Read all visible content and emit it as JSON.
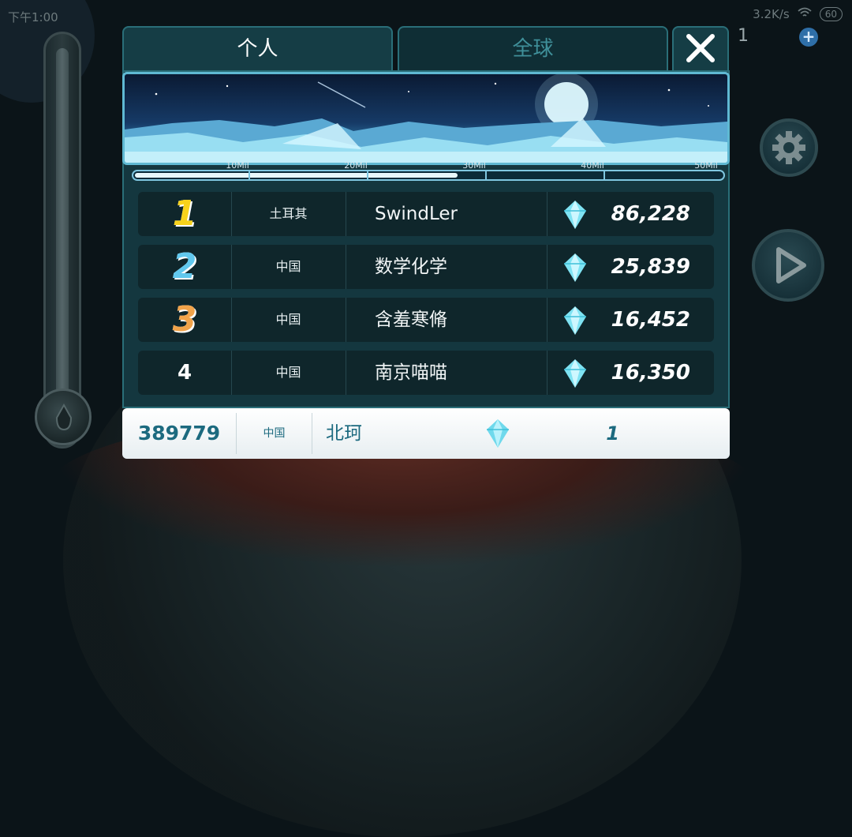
{
  "status_bar": {
    "time": "下午1:00",
    "network_speed": "3.2K/s",
    "battery": "60"
  },
  "top_counter": {
    "value": "1",
    "plus_label": "+"
  },
  "tabs": [
    {
      "label": "个人",
      "active": true
    },
    {
      "label": "全球",
      "active": false
    }
  ],
  "close_label": "✕",
  "progress": {
    "ticks": [
      "10Mil",
      "20Mil",
      "30Mil",
      "40Mil",
      "50Mil"
    ],
    "fraction": 0.55
  },
  "leaderboard": [
    {
      "rank": "1",
      "country": "土耳其",
      "name": "SwindLer",
      "score": "86,228",
      "medal_color": "#f7d21b"
    },
    {
      "rank": "2",
      "country": "中国",
      "name": "数学化学",
      "score": "25,839",
      "medal_color": "#61c8ee"
    },
    {
      "rank": "3",
      "country": "中国",
      "name": "含羞寒脩",
      "score": "16,452",
      "medal_color": "#f1a34a"
    },
    {
      "rank": "4",
      "country": "中国",
      "name": "南京喵喵",
      "score": "16,350",
      "medal_color": "#ffffff"
    }
  ],
  "self": {
    "rank": "389779",
    "country": "中国",
    "name": "北珂",
    "score": "1"
  },
  "colors": {
    "accent": "#2a6e78",
    "gem": "#7fe3f3"
  }
}
